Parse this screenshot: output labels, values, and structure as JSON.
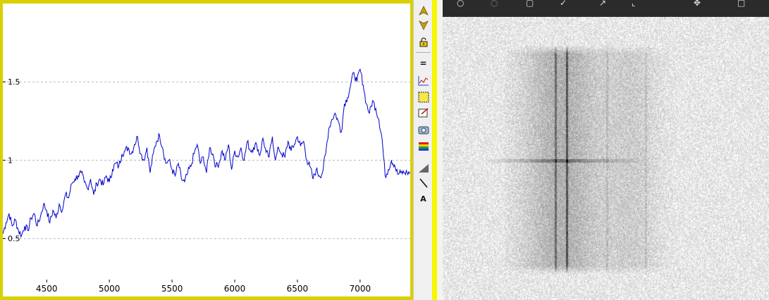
{
  "chart_data": {
    "type": "line",
    "title": "",
    "xlabel": "",
    "ylabel": "",
    "xlim": [
      4150,
      7400
    ],
    "ylim": [
      0.13,
      2.0
    ],
    "x_ticks": [
      "4500",
      "5000",
      "5500",
      "6000",
      "6500",
      "7000"
    ],
    "y_ticks": [
      "0.5",
      "1",
      "1.5"
    ],
    "grid": "horizontal dashed",
    "series": [
      {
        "color": "#0000c8",
        "x": [
          4150,
          4175,
          4200,
          4225,
          4250,
          4275,
          4300,
          4325,
          4350,
          4375,
          4400,
          4425,
          4450,
          4475,
          4500,
          4525,
          4550,
          4575,
          4600,
          4625,
          4650,
          4675,
          4700,
          4725,
          4750,
          4775,
          4800,
          4825,
          4850,
          4875,
          4900,
          4925,
          4950,
          4975,
          5000,
          5025,
          5050,
          5075,
          5100,
          5125,
          5150,
          5175,
          5200,
          5225,
          5250,
          5275,
          5300,
          5325,
          5350,
          5375,
          5400,
          5425,
          5450,
          5475,
          5500,
          5525,
          5550,
          5575,
          5600,
          5625,
          5650,
          5675,
          5700,
          5725,
          5750,
          5775,
          5800,
          5825,
          5850,
          5875,
          5900,
          5925,
          5950,
          5975,
          6000,
          6025,
          6050,
          6075,
          6100,
          6125,
          6150,
          6175,
          6200,
          6225,
          6250,
          6275,
          6300,
          6325,
          6350,
          6375,
          6400,
          6425,
          6450,
          6475,
          6500,
          6525,
          6550,
          6575,
          6600,
          6625,
          6650,
          6675,
          6700,
          6725,
          6750,
          6775,
          6800,
          6825,
          6850,
          6875,
          6900,
          6925,
          6950,
          6975,
          7000,
          7025,
          7050,
          7075,
          7100,
          7125,
          7150,
          7175,
          7200,
          7225,
          7250,
          7275,
          7300,
          7325,
          7350,
          7375,
          7400
        ],
        "y": [
          0.53,
          0.6,
          0.66,
          0.58,
          0.62,
          0.55,
          0.52,
          0.58,
          0.55,
          0.63,
          0.66,
          0.58,
          0.64,
          0.72,
          0.68,
          0.6,
          0.68,
          0.63,
          0.72,
          0.68,
          0.78,
          0.76,
          0.85,
          0.88,
          0.9,
          0.92,
          0.86,
          0.82,
          0.88,
          0.78,
          0.85,
          0.88,
          0.84,
          0.9,
          0.86,
          0.94,
          0.98,
          0.96,
          1.04,
          1.06,
          1.08,
          1.04,
          1.1,
          1.15,
          1.04,
          1.0,
          1.08,
          0.92,
          1.04,
          1.12,
          1.16,
          1.08,
          0.98,
          1.0,
          0.94,
          0.9,
          0.98,
          0.88,
          0.86,
          0.92,
          0.96,
          1.04,
          1.1,
          0.98,
          1.02,
          0.92,
          1.08,
          1.04,
          0.96,
          0.98,
          1.06,
          1.0,
          1.1,
          0.94,
          1.06,
          1.02,
          1.08,
          1.0,
          1.12,
          1.06,
          1.08,
          1.1,
          1.03,
          1.14,
          1.05,
          1.02,
          1.15,
          1.0,
          1.08,
          1.04,
          1.02,
          1.12,
          1.06,
          1.1,
          1.15,
          1.09,
          1.12,
          1.0,
          0.96,
          0.88,
          0.94,
          0.9,
          0.92,
          1.04,
          1.2,
          1.26,
          1.3,
          1.25,
          1.18,
          1.36,
          1.4,
          1.48,
          1.56,
          1.5,
          1.58,
          1.48,
          1.36,
          1.3,
          1.38,
          1.33,
          1.26,
          1.14,
          0.9,
          0.94,
          1.0,
          0.97,
          0.91,
          0.92,
          0.92,
          0.92,
          0.92
        ]
      }
    ]
  },
  "toolbar": {
    "items": [
      "up-arrow-icon",
      "down-arrow-icon",
      "lock-icon",
      "equals-icon",
      "line-chart-icon",
      "selection-icon",
      "pointer-icon",
      "camera-icon",
      "rainbow-icon",
      "gradient-icon",
      "line-tool-icon",
      "text-tool-icon"
    ],
    "text_label": "A",
    "equals_label": "="
  },
  "image_toolbar": {
    "items": [
      "zoom-in-icon",
      "zoom-out-icon",
      "trash-icon",
      "check-icon",
      "expand-icon",
      "crop-icon",
      "tools-icon",
      "export-icon"
    ]
  }
}
